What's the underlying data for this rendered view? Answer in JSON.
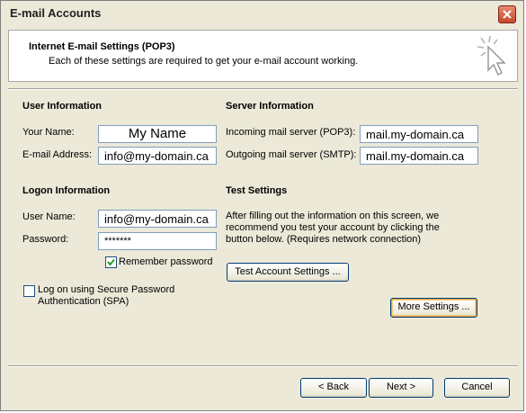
{
  "window": {
    "title": "E-mail Accounts"
  },
  "header": {
    "title": "Internet E-mail Settings (POP3)",
    "subtitle": "Each of these settings are required to get your e-mail account working."
  },
  "user_info": {
    "heading": "User Information",
    "name_label": "Your Name:",
    "name_value": "My Name",
    "email_label": "E-mail Address:",
    "email_value": "info@my-domain.ca"
  },
  "server_info": {
    "heading": "Server Information",
    "incoming_label": "Incoming mail server (POP3):",
    "incoming_value": "mail.my-domain.ca",
    "outgoing_label": "Outgoing mail server (SMTP):",
    "outgoing_value": "mail.my-domain.ca"
  },
  "logon_info": {
    "heading": "Logon Information",
    "username_label": "User Name:",
    "username_value": "info@my-domain.ca",
    "password_label": "Password:",
    "password_value": "*******",
    "remember_label": "Remember password",
    "remember_checked": true,
    "spa_label_line1": "Log on using Secure Password",
    "spa_label_line2": "Authentication (SPA)",
    "spa_checked": false
  },
  "test_settings": {
    "heading": "Test Settings",
    "description": "After filling out the information on this screen, we recommend you test your account by clicking the button below. (Requires network connection)",
    "test_button": "Test Account Settings ...",
    "more_button": "More Settings ..."
  },
  "footer": {
    "back_button": "< Back",
    "next_button": "Next >",
    "cancel_button": "Cancel"
  },
  "colors": {
    "header_bg": "#ffffff",
    "dialog_bg": "#ece9d8",
    "close_button": "#c9452b",
    "field_border": "#7f9db9"
  },
  "icons": {
    "close": "close-icon",
    "wizard": "wizard-cursor-icon",
    "check": "checkmark-icon"
  }
}
